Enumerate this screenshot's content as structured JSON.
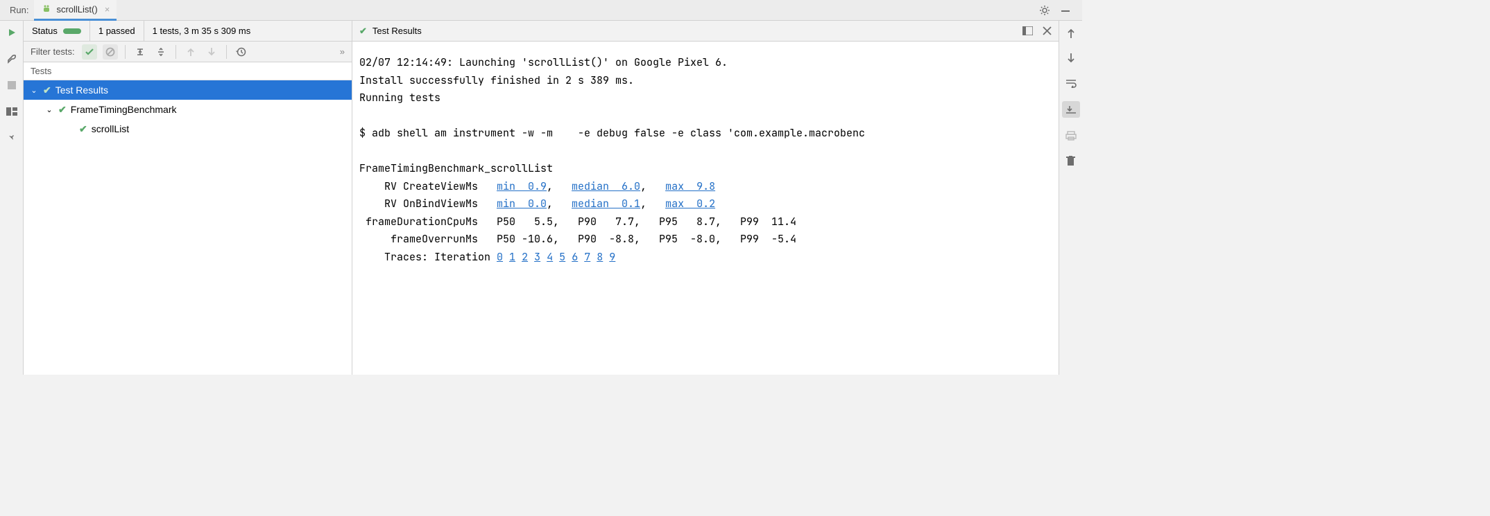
{
  "tab": {
    "run_label": "Run:",
    "title": "scrollList()"
  },
  "status": {
    "label": "Status",
    "passed": "1 passed",
    "summary": "1 tests, 3 m 35 s 309 ms"
  },
  "console_header": {
    "title": "Test Results"
  },
  "filter": {
    "label": "Filter tests:"
  },
  "tree": {
    "header": "Tests",
    "root": "Test Results",
    "class_name": "FrameTimingBenchmark",
    "test_name": "scrollList"
  },
  "console": {
    "line1": "02/07 12:14:49: Launching 'scrollList()' on Google Pixel 6.",
    "line2": "Install successfully finished in 2 s 389 ms.",
    "line3": "Running tests",
    "line4": "",
    "line5": "$ adb shell am instrument -w -m    -e debug false -e class 'com.example.macrobenc",
    "line6": "",
    "bench_title": "FrameTimingBenchmark_scrollList",
    "rv_create_label": "RV CreateViewMs",
    "rv_bind_label": "RV OnBindViewMs",
    "cpu_label": "frameDurationCpuMs",
    "overrun_label": "frameOverrunMs",
    "traces_label": "Traces: Iteration",
    "links": {
      "create_min": "min  0.9",
      "create_med": "median  6.0",
      "create_max": "max  9.8",
      "bind_min": "min  0.0",
      "bind_med": "median  0.1",
      "bind_max": "max  0.2"
    },
    "cpu_values": "P50   5.5,   P90   7.7,   P95   8.7,   P99  11.4",
    "overrun_values": "P50 -10.6,   P90  -8.8,   P95  -8.0,   P99  -5.4",
    "iteration_links": [
      "0",
      "1",
      "2",
      "3",
      "4",
      "5",
      "6",
      "7",
      "8",
      "9"
    ]
  },
  "chart_data": {
    "type": "table",
    "title": "FrameTimingBenchmark_scrollList",
    "metrics": [
      {
        "name": "RV CreateViewMs",
        "min": 0.9,
        "median": 6.0,
        "max": 9.8
      },
      {
        "name": "RV OnBindViewMs",
        "min": 0.0,
        "median": 0.1,
        "max": 0.2
      },
      {
        "name": "frameDurationCpuMs",
        "P50": 5.5,
        "P90": 7.7,
        "P95": 8.7,
        "P99": 11.4
      },
      {
        "name": "frameOverrunMs",
        "P50": -10.6,
        "P90": -8.8,
        "P95": -8.0,
        "P99": -5.4
      }
    ],
    "iterations": [
      0,
      1,
      2,
      3,
      4,
      5,
      6,
      7,
      8,
      9
    ]
  }
}
